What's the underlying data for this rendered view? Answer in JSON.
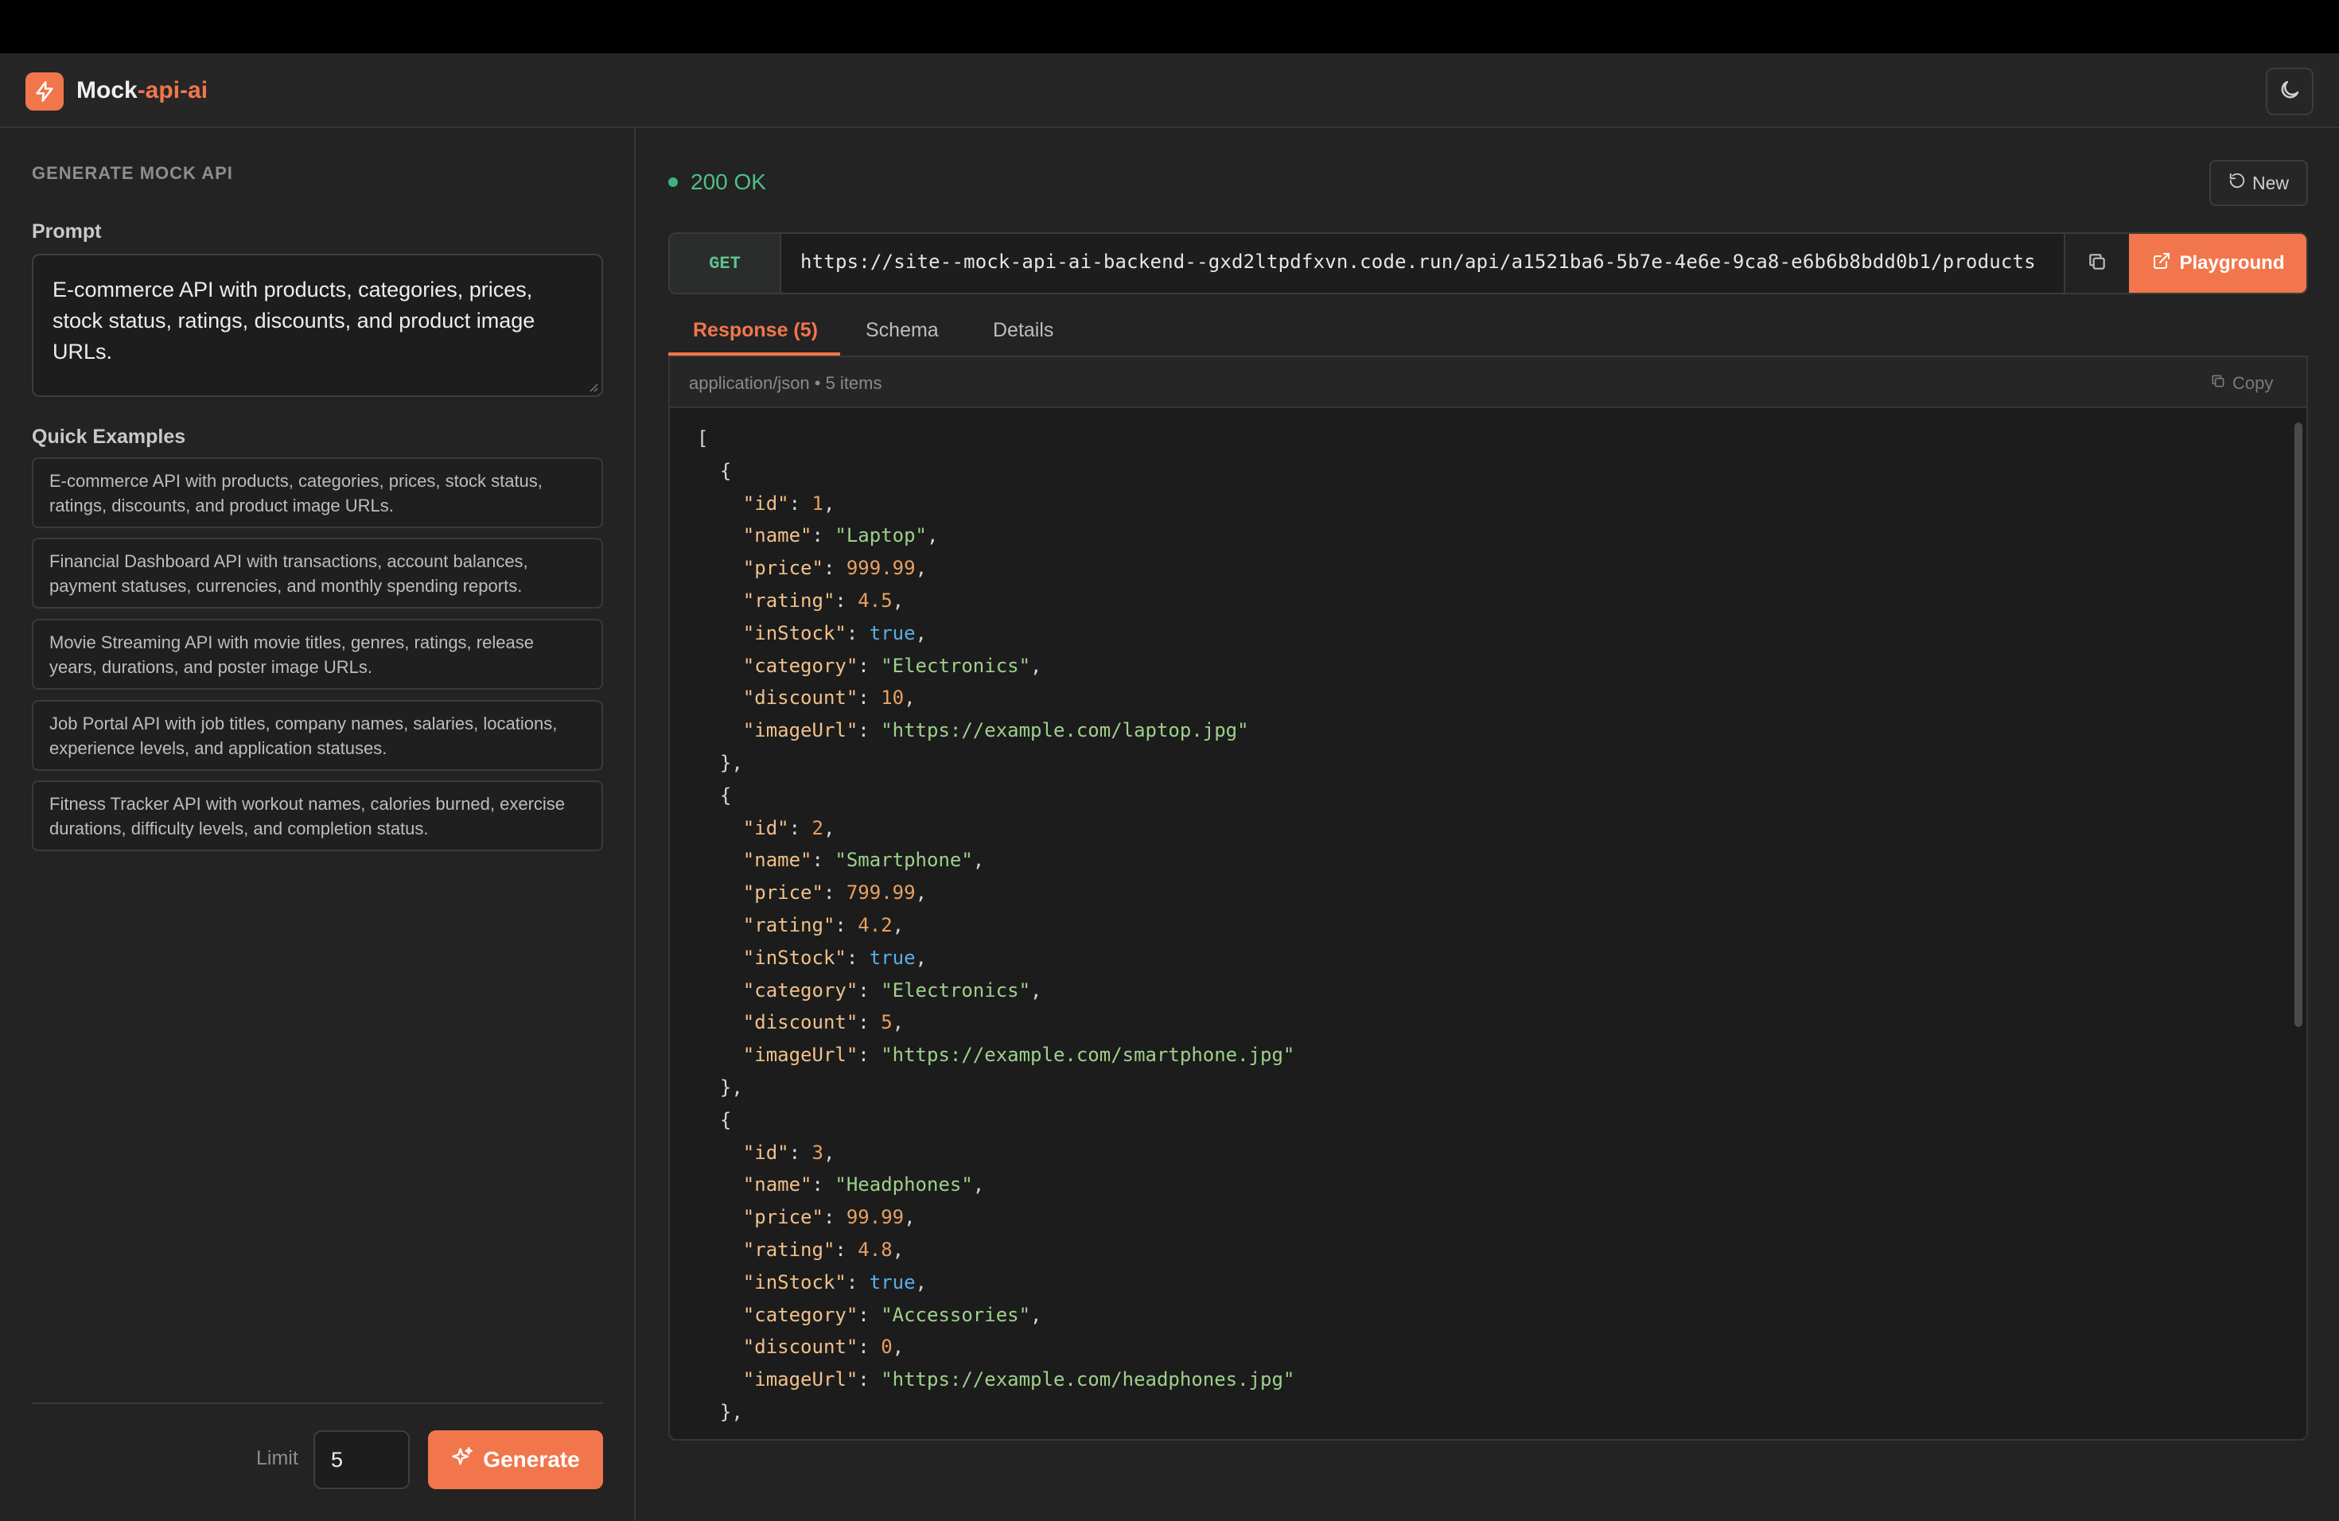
{
  "header": {
    "brand_main": "Mock",
    "brand_accent": "-api-ai"
  },
  "left": {
    "section_title": "GENERATE MOCK API",
    "prompt_label": "Prompt",
    "prompt_value": "E-commerce API with products, categories, prices, stock status, ratings, discounts, and product image URLs.",
    "quick_examples_label": "Quick Examples",
    "quick_examples": [
      "E-commerce API with products, categories, prices, stock status, ratings, discounts, and product image URLs.",
      "Financial Dashboard API with transactions, account balances, payment statuses, currencies, and monthly spending reports.",
      "Movie Streaming API with movie titles, genres, ratings, release years, durations, and poster image URLs.",
      "Job Portal API with job titles, company names, salaries, locations, experience levels, and application statuses.",
      "Fitness Tracker API with workout names, calories burned, exercise durations, difficulty levels, and completion status."
    ],
    "limit_label": "Limit",
    "limit_value": "5",
    "generate_label": "Generate"
  },
  "right": {
    "status": "200 OK",
    "new_label": "New",
    "method": "GET",
    "url": "https://site--mock-api-ai-backend--gxd2ltpdfxvn.code.run/api/a1521ba6-5b7e-4e6e-9ca8-e6b6b8bdd0b1/products",
    "playground_label": "Playground",
    "tabs": [
      "Response (5)",
      "Schema",
      "Details"
    ],
    "response_meta": "application/json • 5 items",
    "copy_label": "Copy"
  },
  "response_items": [
    {
      "id": "1",
      "name": "\"Laptop\"",
      "price": "999.99",
      "rating": "4.5",
      "inStock": "true",
      "category": "\"Electronics\"",
      "discount": "10",
      "imageUrl": "\"https://example.com/laptop.jpg\""
    },
    {
      "id": "2",
      "name": "\"Smartphone\"",
      "price": "799.99",
      "rating": "4.2",
      "inStock": "true",
      "category": "\"Electronics\"",
      "discount": "5",
      "imageUrl": "\"https://example.com/smartphone.jpg\""
    },
    {
      "id": "3",
      "name": "\"Headphones\"",
      "price": "99.99",
      "rating": "4.8",
      "inStock": "true",
      "category": "\"Accessories\"",
      "discount": "0",
      "imageUrl": "\"https://example.com/headphones.jpg\""
    }
  ],
  "colors": {
    "accent": "#f2764b",
    "status_ok": "#4fbf87",
    "json_key": "#f0c08a",
    "json_number": "#e8a062",
    "json_string": "#9ed08a",
    "json_bool": "#5aaee6"
  },
  "icons": {
    "logo": "lightning-icon",
    "theme": "moon-icon",
    "new": "refresh-icon",
    "copy": "copy-icon",
    "playground": "external-link-icon",
    "generate": "sparkles-icon"
  }
}
